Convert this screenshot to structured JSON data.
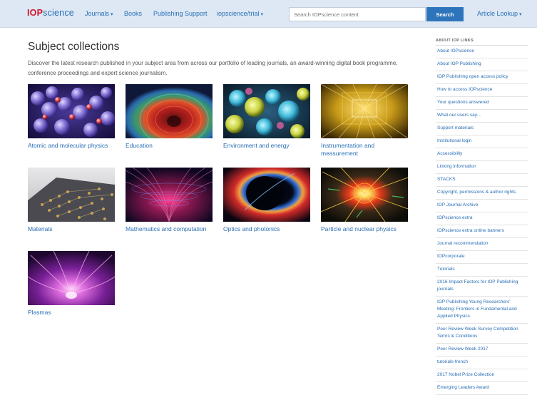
{
  "header": {
    "logo_part1": "IOP",
    "logo_part2": "science",
    "nav": [
      {
        "label": "Journals",
        "caret": "▾"
      },
      {
        "label": "Books"
      },
      {
        "label": "Publishing Support"
      },
      {
        "label": "iopscience/trial",
        "caret": "▾"
      }
    ],
    "search_placeholder": "Search IOPscience content",
    "search_button": "Search",
    "article_lookup": "Article Lookup",
    "article_lookup_caret": "▾"
  },
  "main": {
    "title": "Subject collections",
    "intro": "Discover the latest research published in your subject area from across our portfolio of leading journals, an award-winning digital book programme, conference proceedings and expert science journalism."
  },
  "collections": [
    {
      "label": "Atomic and molecular physics",
      "icon": "atomic-molecular-image"
    },
    {
      "label": "Education",
      "icon": "education-image"
    },
    {
      "label": "Environment and energy",
      "icon": "environment-energy-image"
    },
    {
      "label": "Instrumentation and measurement",
      "icon": "instrumentation-image"
    },
    {
      "label": "Materials",
      "icon": "materials-image"
    },
    {
      "label": "Mathematics and computation",
      "icon": "mathematics-image"
    },
    {
      "label": "Optics and photonics",
      "icon": "optics-image"
    },
    {
      "label": "Particle and nuclear physics",
      "icon": "particle-nuclear-image"
    },
    {
      "label": "Plasmas",
      "icon": "plasmas-image"
    }
  ],
  "sidebar": {
    "heading": "ABOUT IOP LINKS",
    "links": [
      "About IOPscience",
      "About IOP Publishing",
      "IOP Publishing open access policy",
      "How to access IOPscience",
      "Your questions answered",
      "What our users say...",
      "Support materials",
      "Institutional login",
      "Accessibility",
      "Linking information",
      "STACKS",
      "Copyright, permissions & author rights",
      "IOP Journal Archive",
      "IOPscience extra",
      "IOPscience extra online banners",
      "Journal recommendation",
      "IOPcorporate",
      "Tutorials",
      "2016 Impact Factors for IOP Publishing journals",
      "IOP Publishing Young Researchers' Meeting: Frontiers in Fundamental and Applied Physics",
      "Peer Review Week Survey Competition Terms & Conditions",
      "Peer Review Week 2017",
      "tutorials-french",
      "2017 Nobel Prize Collection",
      "Emerging Leaders Award"
    ]
  }
}
